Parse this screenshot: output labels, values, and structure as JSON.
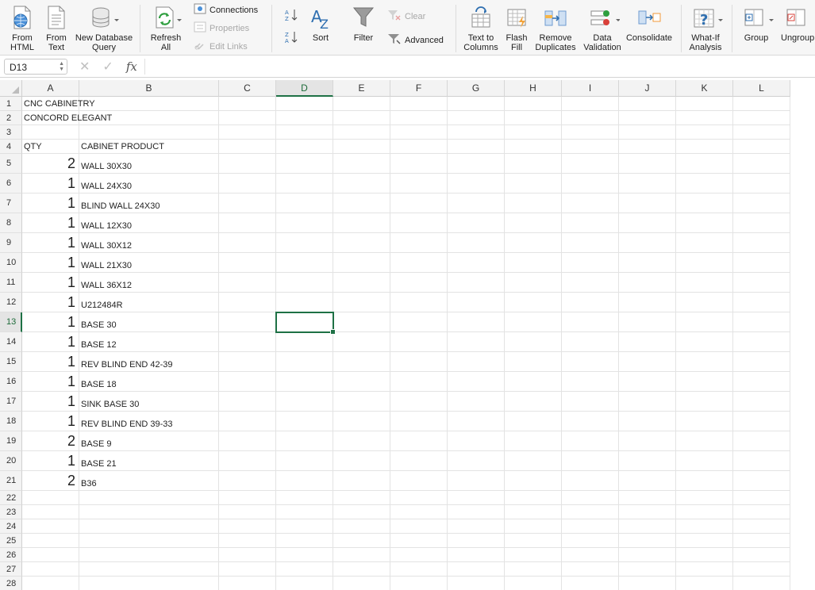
{
  "ribbon": {
    "buttons": [
      {
        "id": "from-html",
        "label1": "From",
        "label2": "HTML",
        "icon": "globe-document-icon"
      },
      {
        "id": "from-text",
        "label1": "From",
        "label2": "Text",
        "icon": "text-document-icon"
      },
      {
        "id": "new-database-query",
        "label1": "New Database",
        "label2": "Query",
        "icon": "database-icon"
      },
      {
        "id": "refresh-all",
        "label1": "Refresh",
        "label2": "All",
        "icon": "refresh-icon"
      },
      {
        "id": "sort",
        "label1": "Sort",
        "label2": "",
        "icon": "sort-az-icon"
      },
      {
        "id": "filter",
        "label1": "Filter",
        "label2": "",
        "icon": "funnel-icon"
      },
      {
        "id": "text-to-columns",
        "label1": "Text to",
        "label2": "Columns",
        "icon": "text-to-columns-icon"
      },
      {
        "id": "flash-fill",
        "label1": "Flash",
        "label2": "Fill",
        "icon": "flash-fill-icon"
      },
      {
        "id": "remove-duplicates",
        "label1": "Remove",
        "label2": "Duplicates",
        "icon": "remove-duplicates-icon"
      },
      {
        "id": "data-validation",
        "label1": "Data",
        "label2": "Validation",
        "icon": "data-validation-icon"
      },
      {
        "id": "consolidate",
        "label1": "Consolidate",
        "label2": "",
        "icon": "consolidate-icon"
      },
      {
        "id": "what-if-analysis",
        "label1": "What-If",
        "label2": "Analysis",
        "icon": "what-if-icon"
      },
      {
        "id": "group",
        "label1": "Group",
        "label2": "",
        "icon": "group-icon"
      },
      {
        "id": "ungroup",
        "label1": "Ungroup",
        "label2": "",
        "icon": "ungroup-icon"
      }
    ],
    "connections": "Connections",
    "properties": "Properties",
    "edit_links": "Edit Links",
    "clear": "Clear",
    "advanced": "Advanced"
  },
  "formula_bar": {
    "name_box": "D13",
    "fx": "fx",
    "cancel": "✕",
    "enter": "✓",
    "content": ""
  },
  "sheet": {
    "columns": [
      "A",
      "B",
      "C",
      "D",
      "E",
      "F",
      "G",
      "H",
      "I",
      "J",
      "K",
      "L"
    ],
    "active_column": "D",
    "active_row": 13,
    "selected_cell": "D13",
    "rows": [
      {
        "n": 1,
        "A": "CNC CABINETRY",
        "B": ""
      },
      {
        "n": 2,
        "A": "CONCORD ELEGANT",
        "B": ""
      },
      {
        "n": 3,
        "A": "",
        "B": ""
      },
      {
        "n": 4,
        "A": "QTY",
        "B": "CABINET PRODUCT"
      },
      {
        "n": 5,
        "A": "2",
        "B": "WALL 30X30"
      },
      {
        "n": 6,
        "A": "1",
        "B": "WALL 24X30"
      },
      {
        "n": 7,
        "A": "1",
        "B": "BLIND WALL 24X30"
      },
      {
        "n": 8,
        "A": "1",
        "B": "WALL 12X30"
      },
      {
        "n": 9,
        "A": "1",
        "B": "WALL 30X12"
      },
      {
        "n": 10,
        "A": "1",
        "B": "WALL 21X30"
      },
      {
        "n": 11,
        "A": "1",
        "B": "WALL 36X12"
      },
      {
        "n": 12,
        "A": "1",
        "B": "U212484R"
      },
      {
        "n": 13,
        "A": "1",
        "B": "BASE 30"
      },
      {
        "n": 14,
        "A": "1",
        "B": "BASE 12"
      },
      {
        "n": 15,
        "A": "1",
        "B": "REV BLIND END 42-39"
      },
      {
        "n": 16,
        "A": "1",
        "B": "BASE 18"
      },
      {
        "n": 17,
        "A": "1",
        "B": "SINK BASE 30"
      },
      {
        "n": 18,
        "A": "1",
        "B": "REV BLIND END 39-33"
      },
      {
        "n": 19,
        "A": "2",
        "B": "BASE 9"
      },
      {
        "n": 20,
        "A": "1",
        "B": "BASE 21"
      },
      {
        "n": 21,
        "A": "2",
        "B": "B36"
      },
      {
        "n": 22,
        "A": "",
        "B": ""
      },
      {
        "n": 23,
        "A": "",
        "B": ""
      },
      {
        "n": 24,
        "A": "",
        "B": ""
      },
      {
        "n": 25,
        "A": "",
        "B": ""
      },
      {
        "n": 26,
        "A": "",
        "B": ""
      },
      {
        "n": 27,
        "A": "",
        "B": ""
      },
      {
        "n": 28,
        "A": "",
        "B": ""
      }
    ]
  },
  "colors": {
    "accent": "#1e7145",
    "ribbon_bg": "#f6f6f6",
    "header_bg": "#f3f3f3",
    "gridline": "#e3e3e3"
  }
}
